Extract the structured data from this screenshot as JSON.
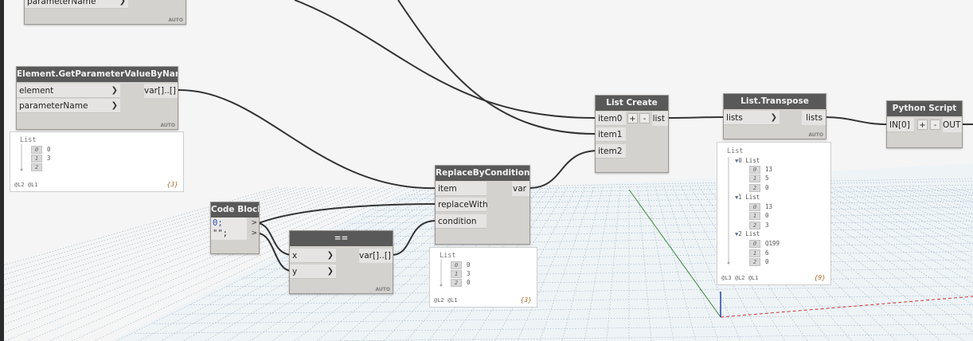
{
  "nodes": {
    "topnode": {
      "port1": "parameterName",
      "lace": "AUTO"
    },
    "getparam": {
      "title": "Element.GetParameterValueByName",
      "in1": "element",
      "in2": "parameterName",
      "out1": "var[]..[]",
      "lace": "AUTO"
    },
    "listcreate": {
      "title": "List Create",
      "in1": "item0",
      "in2": "item1",
      "in3": "item2",
      "out1": "list",
      "plus": "+",
      "minus": "-"
    },
    "transpose": {
      "title": "List.Transpose",
      "in1": "lists",
      "out1": "lists",
      "lace": "AUTO"
    },
    "python": {
      "title": "Python Script",
      "in1": "IN[0]",
      "out1": "OUT",
      "plus": "+",
      "minus": "-"
    },
    "replace": {
      "title": "ReplaceByCondition",
      "in1": "item",
      "in2": "replaceWith",
      "in3": "condition",
      "out1": "var"
    },
    "codeblock": {
      "title": "Code Block",
      "line1": "0;",
      "line2": "\"\";"
    },
    "equals": {
      "title": "==",
      "in1": "x",
      "in2": "y",
      "out1": "var[]..[]",
      "lace": "AUTO"
    }
  },
  "watches": {
    "getparam": {
      "title": "List",
      "items": [
        {
          "idx": "0",
          "val": "0"
        },
        {
          "idx": "1",
          "val": "3"
        },
        {
          "idx": "2",
          "val": ""
        }
      ],
      "levels": "@L2 @L1",
      "count": "{3}"
    },
    "replace": {
      "title": "List",
      "items": [
        {
          "idx": "0",
          "val": "0"
        },
        {
          "idx": "1",
          "val": "3"
        },
        {
          "idx": "2",
          "val": "0"
        }
      ],
      "levels": "@L2 @L1",
      "count": "{3}"
    },
    "transpose": {
      "title": "List",
      "groups": [
        {
          "label": "List",
          "idx": "0",
          "items": [
            {
              "idx": "0",
              "val": "13"
            },
            {
              "idx": "1",
              "val": "5"
            },
            {
              "idx": "2",
              "val": "0"
            }
          ]
        },
        {
          "label": "List",
          "idx": "1",
          "items": [
            {
              "idx": "0",
              "val": "13"
            },
            {
              "idx": "1",
              "val": "0"
            },
            {
              "idx": "2",
              "val": "3"
            }
          ]
        },
        {
          "label": "List",
          "idx": "2",
          "items": [
            {
              "idx": "0",
              "val": "Q199"
            },
            {
              "idx": "1",
              "val": "6"
            },
            {
              "idx": "2",
              "val": "0"
            }
          ]
        }
      ],
      "levels": "@L3 @L2 @L1",
      "count": "{9}"
    }
  },
  "colors": {
    "node_header": "#595959",
    "node_body": "#d4d2cf",
    "wire": "#333333",
    "grid": "#9bb3c4",
    "axis_red": "#cc3333",
    "axis_green": "#3a8a3a",
    "axis_blue": "#2244aa"
  }
}
